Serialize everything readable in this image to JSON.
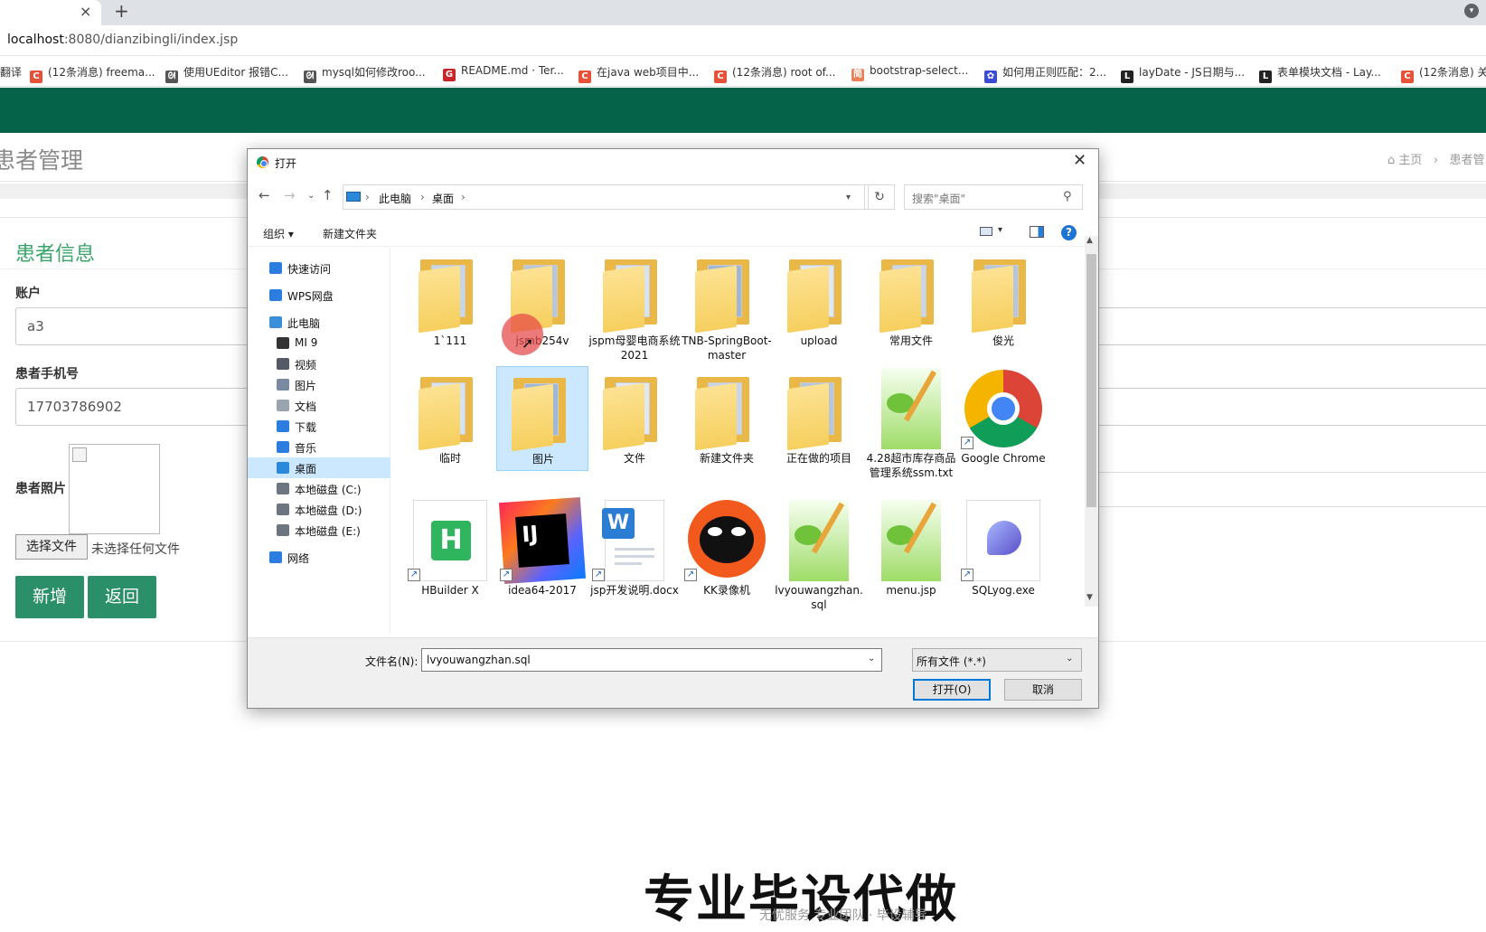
{
  "browser": {
    "tab_close": "×",
    "new_tab": "+",
    "url_host": "localhost",
    "url_rest": ":8080/dianzibingli/index.jsp",
    "bookmarks": [
      {
        "label": "翻译",
        "color": "#1a73e8",
        "glyph": ""
      },
      {
        "label": "(12条消息) freema...",
        "color": "#e6513a",
        "glyph": "C"
      },
      {
        "label": "使用UEditor 报错C...",
        "color": "#555555",
        "glyph": "ᘛ"
      },
      {
        "label": "mysql如何修改roo...",
        "color": "#555555",
        "glyph": "ᘛ"
      },
      {
        "label": "README.md · Ter...",
        "color": "#c8262a",
        "glyph": "G"
      },
      {
        "label": "在java web项目中...",
        "color": "#e6513a",
        "glyph": "C"
      },
      {
        "label": "(12条消息) root of...",
        "color": "#e6513a",
        "glyph": "C"
      },
      {
        "label": "bootstrap-select...",
        "color": "#e9825a",
        "glyph": "简"
      },
      {
        "label": "如何用正则匹配：2...",
        "color": "#3b4bd8",
        "glyph": "✿"
      },
      {
        "label": "layDate - JS日期与...",
        "color": "#222222",
        "glyph": "L"
      },
      {
        "label": "表单模块文档 - Lay...",
        "color": "#222222",
        "glyph": "L"
      },
      {
        "label": "(12条消息) 关",
        "color": "#e6513a",
        "glyph": "C"
      }
    ]
  },
  "page": {
    "title": "患者管理",
    "breadcrumb_home": "主页",
    "breadcrumb_sep": "›",
    "breadcrumb_current": "患者管",
    "section_title": "患者信息",
    "account_label": "账户",
    "account_value": "a3",
    "phone_label": "患者手机号",
    "phone_value": "17703786902",
    "photo_label": "患者照片",
    "choose_file": "选择文件",
    "no_file": "未选择任何文件",
    "add_button": "新增",
    "back_button": "返回"
  },
  "watermark": {
    "text": "专业毕设代做",
    "subtext": "无忧服务 专业团队 · 毕设辅导"
  },
  "dialog": {
    "title": "打开",
    "close": "✕",
    "path": [
      "此电脑",
      "桌面"
    ],
    "search_placeholder": "搜索\"桌面\"",
    "organize": "组织 ▾",
    "new_folder": "新建文件夹",
    "help": "?",
    "nav_items": [
      {
        "label": "快速访问",
        "icon": "star-icon",
        "color": "#2b7de0",
        "indent": 1
      },
      {
        "label": "WPS网盘",
        "icon": "cloud-icon",
        "color": "#2b7de0",
        "indent": 1
      },
      {
        "label": "此电脑",
        "icon": "computer-icon",
        "color": "#3b8fd8",
        "indent": 1
      },
      {
        "label": "MI 9",
        "icon": "phone-icon",
        "color": "#333333",
        "indent": 2
      },
      {
        "label": "视频",
        "icon": "video-icon",
        "color": "#555a66",
        "indent": 2
      },
      {
        "label": "图片",
        "icon": "picture-icon",
        "color": "#7a8aa0",
        "indent": 2
      },
      {
        "label": "文档",
        "icon": "document-icon",
        "color": "#9aa4b0",
        "indent": 2
      },
      {
        "label": "下载",
        "icon": "download-icon",
        "color": "#2b7de0",
        "indent": 2
      },
      {
        "label": "音乐",
        "icon": "music-icon",
        "color": "#2b7de0",
        "indent": 2
      },
      {
        "label": "桌面",
        "icon": "desktop-icon",
        "color": "#2a8ad9",
        "indent": 2
      },
      {
        "label": "本地磁盘 (C:)",
        "icon": "drive-icon",
        "color": "#6d7580",
        "indent": 2
      },
      {
        "label": "本地磁盘 (D:)",
        "icon": "drive-icon",
        "color": "#6d7580",
        "indent": 2
      },
      {
        "label": "本地磁盘 (E:)",
        "icon": "drive-icon",
        "color": "#6d7580",
        "indent": 2
      },
      {
        "label": "网络",
        "icon": "network-icon",
        "color": "#2b7de0",
        "indent": 1
      }
    ],
    "files": [
      {
        "name": "1`111",
        "kind": "folder"
      },
      {
        "name": "jsmb254v",
        "kind": "folder"
      },
      {
        "name": "jspm母婴电商系统2021",
        "kind": "folder"
      },
      {
        "name": "TNB-SpringBoot-master",
        "kind": "folder"
      },
      {
        "name": "upload",
        "kind": "folder"
      },
      {
        "name": "常用文件",
        "kind": "folder"
      },
      {
        "name": "俊光",
        "kind": "folder"
      },
      {
        "name": "临时",
        "kind": "folder"
      },
      {
        "name": "图片",
        "kind": "folder"
      },
      {
        "name": "文件",
        "kind": "folder"
      },
      {
        "name": "新建文件夹",
        "kind": "folder"
      },
      {
        "name": "正在做的项目",
        "kind": "folder"
      },
      {
        "name": "4.28超市库存商品管理系统ssm.txt",
        "kind": "notepad"
      },
      {
        "name": "Google Chrome",
        "kind": "chrome"
      },
      {
        "name": "HBuilder X",
        "kind": "hbuilder"
      },
      {
        "name": "idea64-2017",
        "kind": "idea"
      },
      {
        "name": "jsp开发说明.docx",
        "kind": "word"
      },
      {
        "name": "KK录像机",
        "kind": "kk"
      },
      {
        "name": "lvyouwangzhan.sql",
        "kind": "notepad"
      },
      {
        "name": "menu.jsp",
        "kind": "notepad"
      },
      {
        "name": "SQLyog.exe",
        "kind": "sqlyog"
      }
    ],
    "filename_label": "文件名(N):",
    "filename_value": "lvyouwangzhan.sql",
    "filetype_value": "所有文件 (*.*)",
    "open_button": "打开(O)",
    "cancel_button": "取消"
  },
  "colors": {
    "brand_green": "#05634a",
    "button_green": "#2b8f6a",
    "section_green": "#3aa36a",
    "selection_blue": "#cce8ff"
  }
}
